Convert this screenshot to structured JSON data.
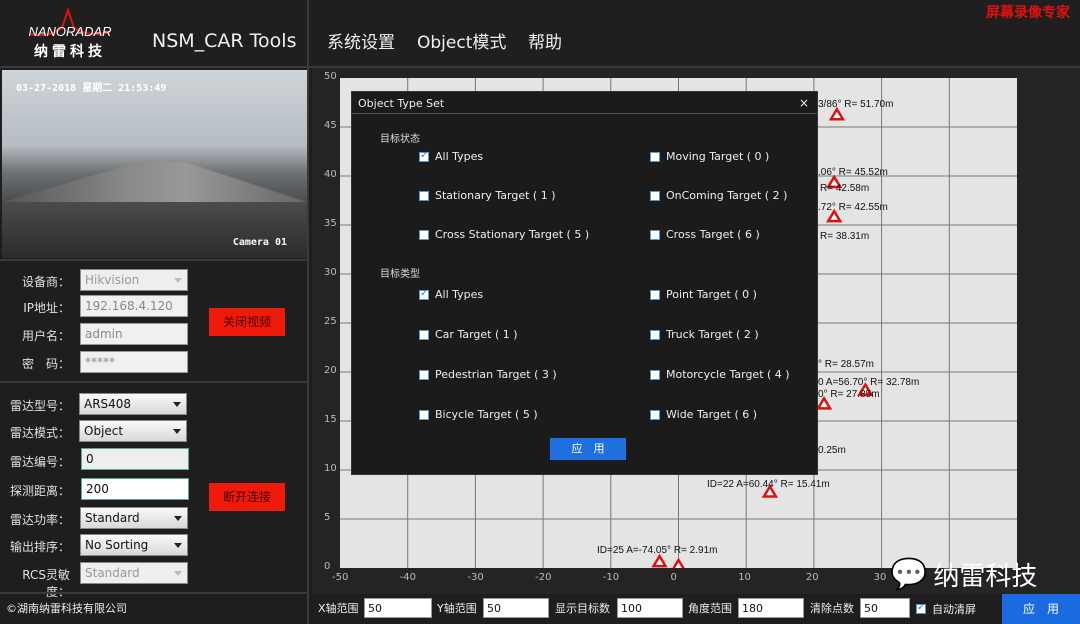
{
  "header": {
    "logo_text": "NANORADAR",
    "logo_cn": "纳雷科技",
    "app_title": "NSM_CAR Tools",
    "menu": [
      "系统设置",
      "Object模式",
      "帮助"
    ],
    "recorder_watermark": "屏幕录像专家"
  },
  "video": {
    "timestamp": "03-27-2018 星期二 21:53:49",
    "camera": "Camera 01"
  },
  "camera_form": {
    "vendor_label": "设备商：",
    "vendor": "Hikvision",
    "ip_label": "IP地址：",
    "ip": "192.168.4.120",
    "user_label": "用户名：",
    "user": "admin",
    "pwd_label": "密　码：",
    "pwd": "*****",
    "close_video": "关闭视频"
  },
  "radar_form": {
    "model_label": "雷达型号：",
    "model": "ARS408",
    "mode_label": "雷达模式：",
    "mode": "Object",
    "id_label": "雷达编号：",
    "id": "0",
    "range_label": "探测距离：",
    "range": "200",
    "power_label": "雷达功率：",
    "power": "Standard",
    "sort_label": "输出排序：",
    "sort": "No Sorting",
    "rcs_label": "RCS灵敏度：",
    "rcs": "Standard",
    "disconnect": "断开连接"
  },
  "footer": {
    "copyright": "©湖南纳雷科技有限公司"
  },
  "plot": {
    "x_ticks": [
      "-50",
      "-40",
      "-30",
      "-20",
      "-10",
      "0",
      "10",
      "20",
      "30"
    ],
    "y_ticks": [
      "50",
      "45",
      "40",
      "35",
      "30",
      "25",
      "20",
      "15",
      "10",
      "5",
      "0"
    ],
    "points": [
      [
        23.4,
        46.2
      ],
      [
        23,
        39.3
      ],
      [
        23,
        35.8
      ],
      [
        13.5,
        7.7
      ],
      [
        -2.8,
        0.6
      ],
      [
        0,
        0.2
      ],
      [
        27.6,
        18.1
      ],
      [
        21.5,
        16.7
      ]
    ],
    "labels": [
      "3/86° R= 51.70m",
      ".06° R= 45.52m",
      "R= 42.58m",
      ".72° R= 42.55m",
      "R= 38.31m",
      "° R= 28.57m",
      "0 A=56.70° R= 32.78m",
      "0° R= 27.85m",
      "0.25m",
      "ID=22 A=60.44° R= 15.41m",
      "ID=25 A=-74.05° R= 2.91m"
    ],
    "marker_color": "#e01010"
  },
  "dialog": {
    "title": "Object Type Set",
    "state_section": "目标状态",
    "type_section": "目标类型",
    "apply": "应　用",
    "state_items": [
      {
        "label": "All Types",
        "checked": true
      },
      {
        "label": "Moving Target ( 0 )",
        "checked": false
      },
      {
        "label": "Stationary Target ( 1 )",
        "checked": false
      },
      {
        "label": "OnComing Target ( 2 )",
        "checked": false
      },
      {
        "label": "Cross Stationary Target ( 5 )",
        "checked": false
      },
      {
        "label": "Cross Target ( 6 )",
        "checked": false
      }
    ],
    "type_items": [
      {
        "label": "All Types",
        "checked": true
      },
      {
        "label": "Point Target ( 0 )",
        "checked": false
      },
      {
        "label": "Car Target ( 1 )",
        "checked": false
      },
      {
        "label": "Truck Target ( 2 )",
        "checked": false
      },
      {
        "label": "Pedestrian Target ( 3 )",
        "checked": false
      },
      {
        "label": "Motorcycle Target ( 4 )",
        "checked": false
      },
      {
        "label": "Bicycle Target ( 5 )",
        "checked": false
      },
      {
        "label": "Wide Target ( 6 )",
        "checked": false
      }
    ]
  },
  "bottom": {
    "x_range_label": "X轴范围",
    "x_range": "50",
    "y_range_label": "Y轴范围",
    "y_range": "50",
    "targets_label": "显示目标数",
    "targets": "100",
    "angle_label": "角度范围",
    "angle": "180",
    "clear_label": "清除点数",
    "clear": "50",
    "auto_clear_label": "自动清屏",
    "auto_clear": true,
    "apply": "应　用"
  },
  "watermark": {
    "text": "纳雷科技"
  }
}
